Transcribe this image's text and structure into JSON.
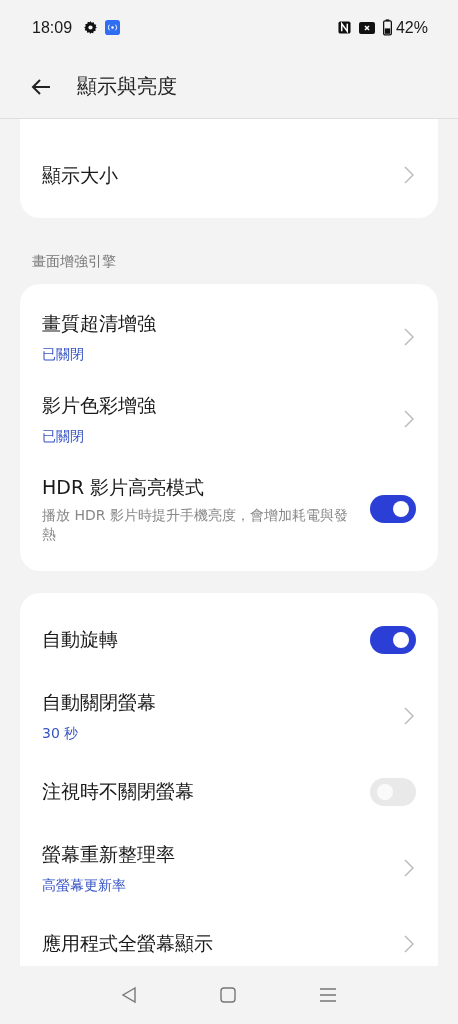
{
  "status_bar": {
    "time": "18:09",
    "battery": "42%"
  },
  "header": {
    "title": "顯示與亮度"
  },
  "groups": [
    {
      "items": [
        {
          "kind": "chevron",
          "title": "顯示大小"
        }
      ]
    },
    {
      "label": "畫面增強引擎",
      "items": [
        {
          "kind": "chevron",
          "title": "畫質超清增強",
          "status": "已關閉"
        },
        {
          "kind": "chevron",
          "title": "影片色彩增強",
          "status": "已關閉"
        },
        {
          "kind": "toggle",
          "title": "HDR 影片高亮模式",
          "description": "播放 HDR 影片時提升手機亮度，會增加耗電與發熱",
          "on": true
        }
      ]
    },
    {
      "items": [
        {
          "kind": "toggle",
          "title": "自動旋轉",
          "on": true
        },
        {
          "kind": "chevron",
          "title": "自動關閉螢幕",
          "status": "30 秒"
        },
        {
          "kind": "toggle",
          "title": "注視時不關閉螢幕",
          "on": false
        },
        {
          "kind": "chevron",
          "title": "螢幕重新整理率",
          "status": "高螢幕更新率"
        },
        {
          "kind": "chevron",
          "title": "應用程式全螢幕顯示"
        }
      ]
    }
  ]
}
